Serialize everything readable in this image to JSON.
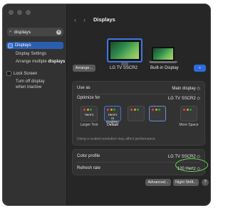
{
  "sidebar": {
    "search": {
      "query": "displays"
    },
    "items": [
      {
        "label": "Displays",
        "active": true
      },
      {
        "label": "Display Settings"
      },
      {
        "label": "Arrange multiple ",
        "bold": "displays"
      },
      {
        "label": "Lock Screen"
      },
      {
        "label": "Turn off display\nwhen inactive"
      }
    ]
  },
  "header": {
    "title": "Displays",
    "back": "‹",
    "forward": "›"
  },
  "monitors": [
    {
      "label": "LG TV SSCR2",
      "selected": true
    },
    {
      "label": "Built-in Display",
      "selected": false
    }
  ],
  "arrange_button": "Arrange...",
  "add_button": "+",
  "settings": {
    "use_as": {
      "label": "Use as",
      "value": "Main display ◇"
    },
    "optimize_for": {
      "label": "Optimize for",
      "value": "LG TV SSCR2 ◇"
    },
    "resolutions": [
      {
        "caption": "Larger Text",
        "preview": "Here's"
      },
      {
        "caption": "Default",
        "preview": "Here's ra troublem",
        "selected": true
      },
      {
        "caption": "",
        "preview": ""
      },
      {
        "caption": "",
        "preview": ""
      },
      {
        "caption": "More Space",
        "preview": ""
      }
    ],
    "note": "Using a scaled resolution may affect performance.",
    "color_profile": {
      "label": "Color profile",
      "value": "LG TV SSCR2 ◇"
    },
    "refresh_rate": {
      "label": "Refresh rate",
      "value": "120 Hertz ◇"
    }
  },
  "footer": {
    "advanced": "Advanced...",
    "night_shift": "Night Shift...",
    "help": "?"
  },
  "colors": {
    "accent": "#2d6be0",
    "highlight": "#5ee049"
  }
}
